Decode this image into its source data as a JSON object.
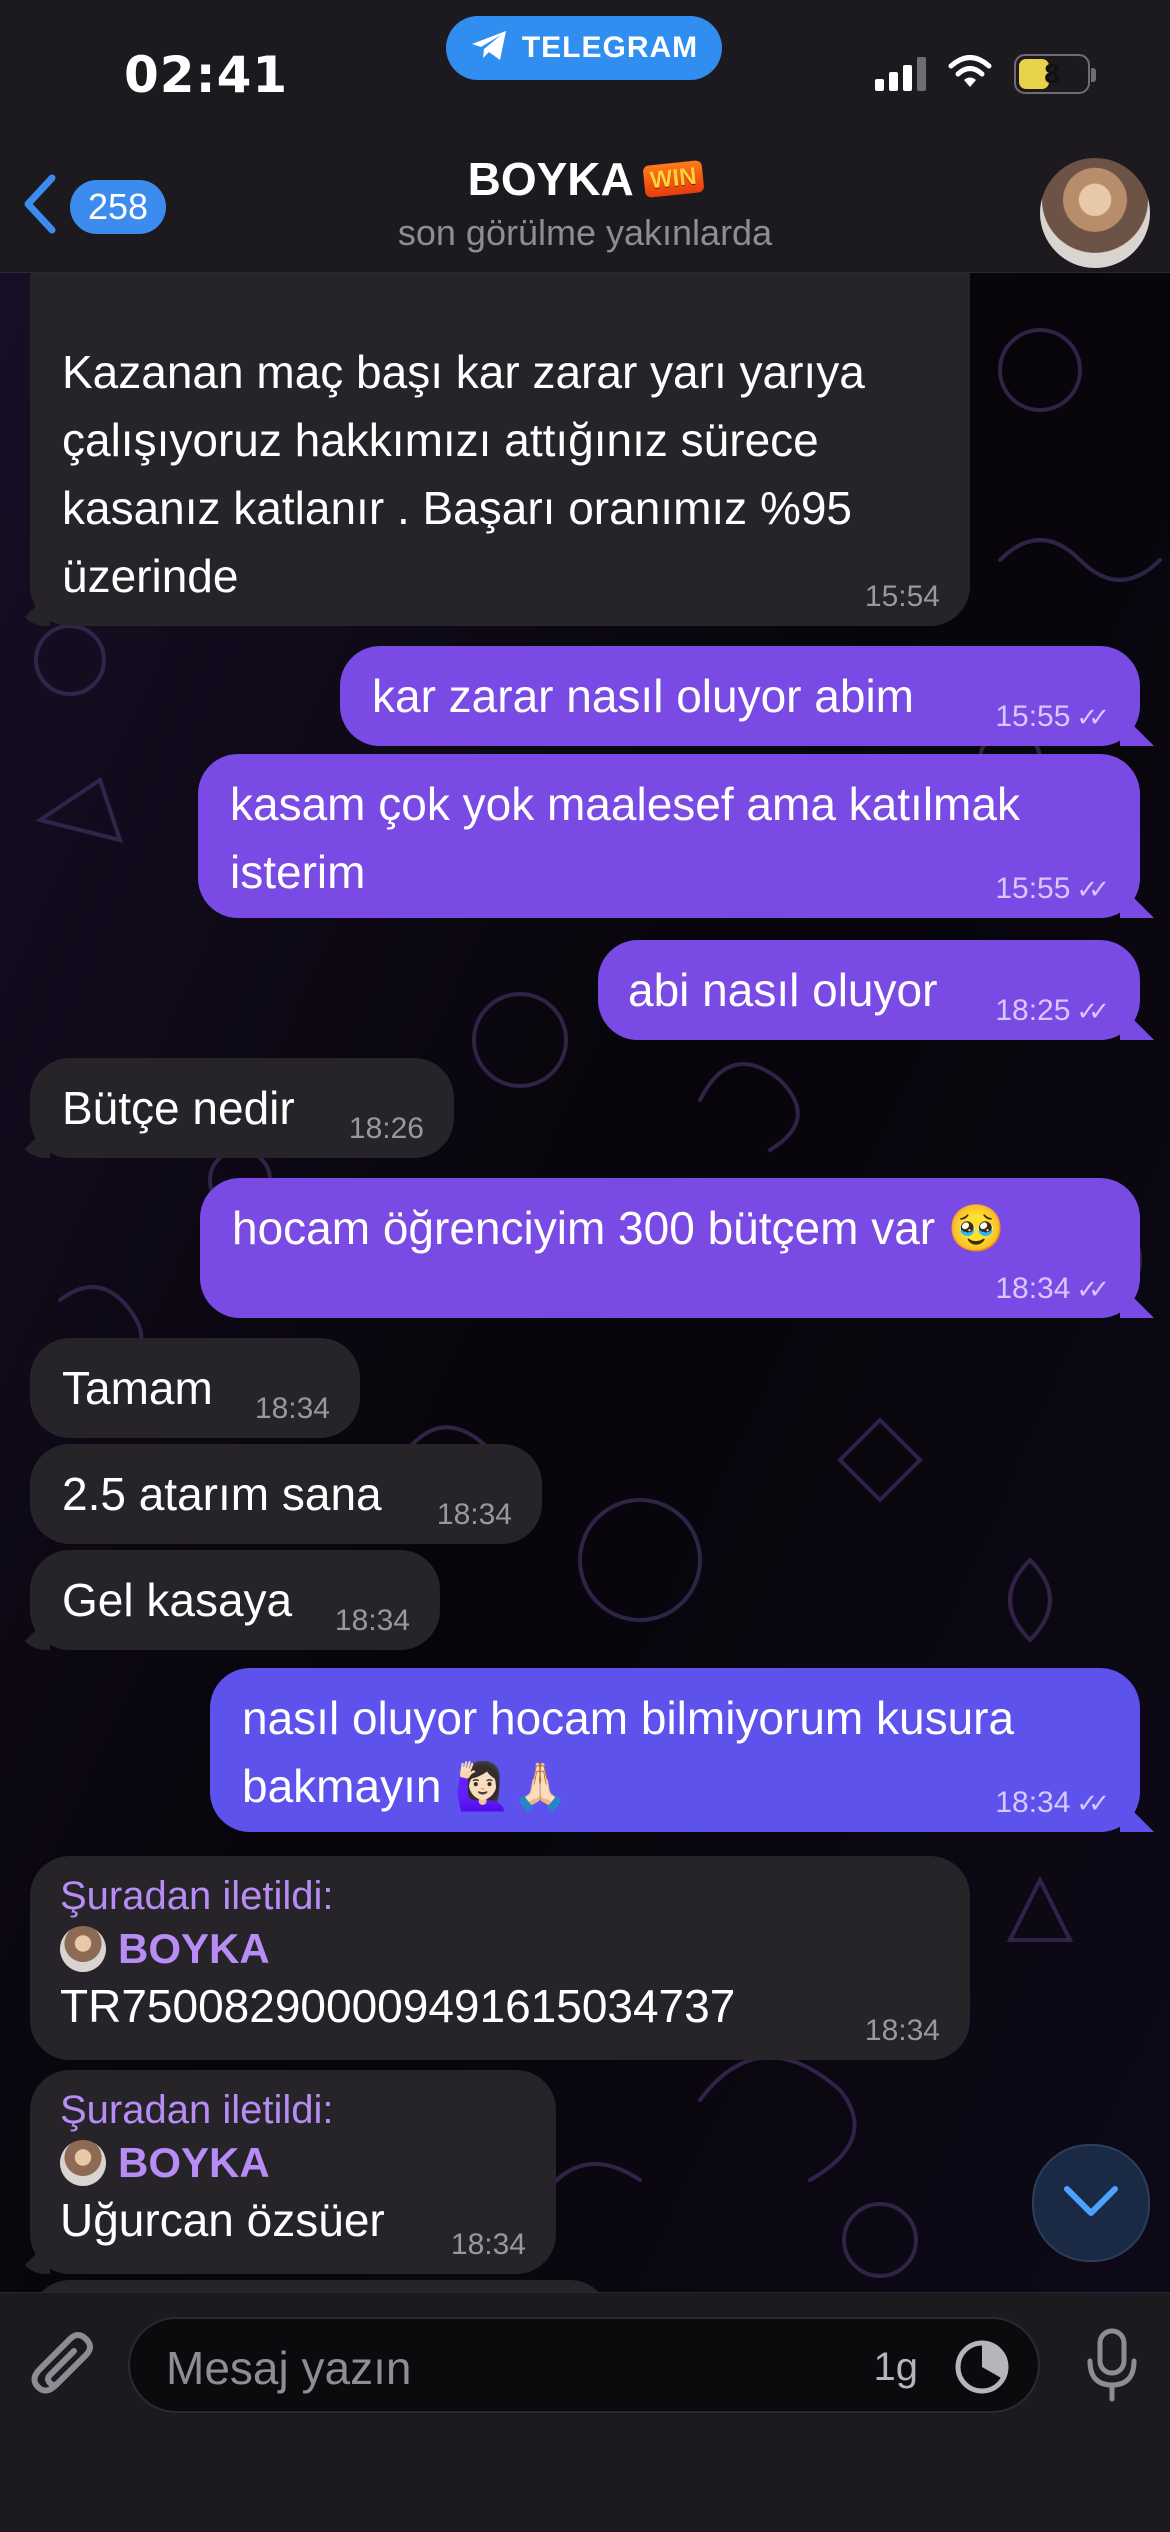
{
  "status_bar": {
    "time": "02:41",
    "pill_label": "TELEGRAM",
    "battery": "8"
  },
  "header": {
    "back_count": "258",
    "title": "BOYKA",
    "title_badge": "WIN",
    "subtitle": "son görülme yakınlarda"
  },
  "messages": [
    {
      "dir": "in",
      "text": "Kazanan maç başı kar zarar yarı yarıya çalışıyoruz hakkımızı attığınız sürece kasanız katlanır . Başarı oranımız %95 üzerinde",
      "time": "15:54"
    },
    {
      "dir": "out",
      "text": "kar zarar nasıl oluyor abim",
      "time": "15:55"
    },
    {
      "dir": "out",
      "text": "kasam çok yok maalesef ama katılmak isterim",
      "time": "15:55"
    },
    {
      "dir": "out",
      "text": "abi nasıl oluyor",
      "time": "18:25"
    },
    {
      "dir": "in",
      "text": "Bütçe nedir",
      "time": "18:26"
    },
    {
      "dir": "out",
      "text": "hocam öğrenciyim 300 bütçem var 🥹",
      "time": "18:34"
    },
    {
      "dir": "in",
      "text": "Tamam",
      "time": "18:34"
    },
    {
      "dir": "in",
      "text": "2.5 atarım sana",
      "time": "18:34"
    },
    {
      "dir": "in",
      "text": "Gel kasaya",
      "time": "18:34"
    },
    {
      "dir": "out",
      "text": "nasıl oluyor hocam bilmiyorum kusura bakmayın 🙋🏻‍♀️🙏🏻",
      "time": "18:34"
    },
    {
      "dir": "in",
      "forwarded_label": "Şuradan iletildi:",
      "forwarded_from": "BOYKA",
      "text": "TR750082900009491615034737",
      "time": "18:34"
    },
    {
      "dir": "in",
      "forwarded_label": "Şuradan iletildi:",
      "forwarded_from": "BOYKA",
      "text": "Uğurcan özsüer",
      "time": "18:34"
    }
  ],
  "composer": {
    "placeholder": "Mesaj yazın",
    "timer_label": "1g"
  },
  "icons": {
    "status_pill": "telegram-plane-icon",
    "back": "chevron-left-icon",
    "attach": "paperclip-icon",
    "timer": "clock-icon",
    "mic": "microphone-icon",
    "scroll": "chevron-down-icon",
    "read": "double-check-icon"
  },
  "colors": {
    "outgoing_bubble": "#7a4ae4",
    "incoming_bubble": "#262429",
    "accent": "#3c8cf0"
  }
}
